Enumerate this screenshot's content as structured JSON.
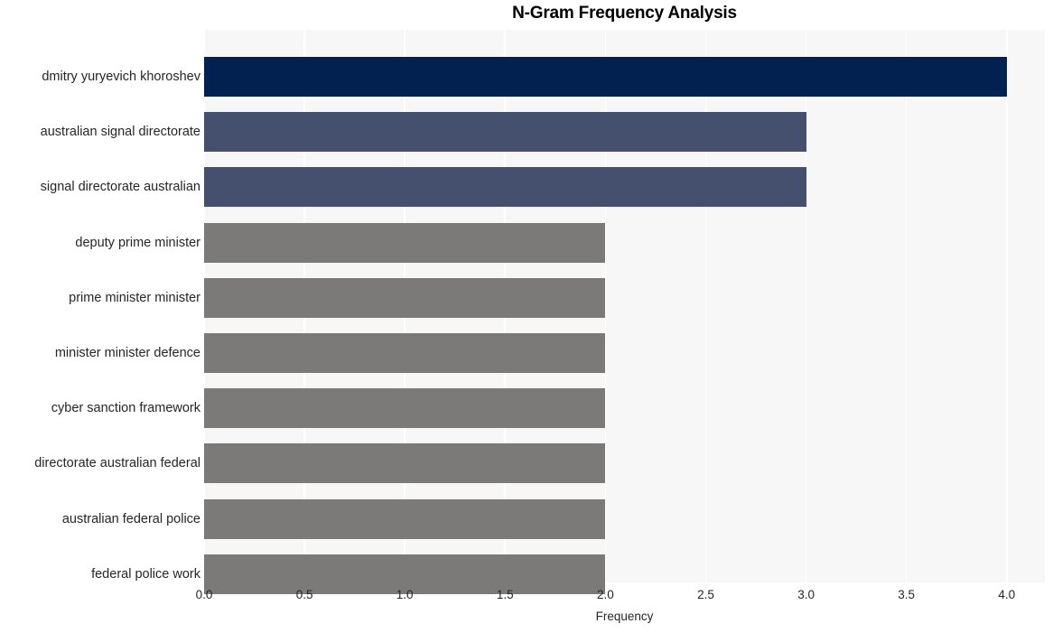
{
  "chart_data": {
    "type": "bar",
    "orientation": "horizontal",
    "title": "N-Gram Frequency Analysis",
    "xlabel": "Frequency",
    "ylabel": "",
    "categories": [
      "dmitry yuryevich khoroshev",
      "australian signal directorate",
      "signal directorate australian",
      "deputy prime minister",
      "prime minister minister",
      "minister minister defence",
      "cyber sanction framework",
      "directorate australian federal",
      "australian federal police",
      "federal police work"
    ],
    "values": [
      4,
      3,
      3,
      2,
      2,
      2,
      2,
      2,
      2,
      2
    ],
    "bar_colors": [
      "#032150",
      "#454f6e",
      "#454f6e",
      "#7b7a78",
      "#7b7a78",
      "#7b7a78",
      "#7b7a78",
      "#7b7a78",
      "#7b7a78",
      "#7b7a78"
    ],
    "xticks": [
      "0.0",
      "0.5",
      "1.0",
      "1.5",
      "2.0",
      "2.5",
      "3.0",
      "3.5",
      "4.0"
    ],
    "xtick_values": [
      0,
      0.5,
      1,
      1.5,
      2,
      2.5,
      3,
      3.5,
      4
    ],
    "xlim": [
      0,
      4.19
    ],
    "grid": true,
    "grid_axis": "x",
    "legend": "none",
    "plot_background": "#f7f7f7",
    "grid_color": "#ffffff",
    "figure_background": "#ffffff"
  }
}
